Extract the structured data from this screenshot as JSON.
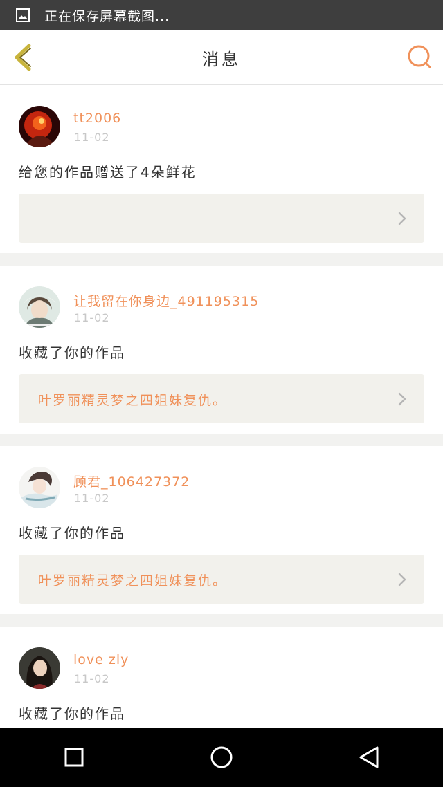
{
  "status_bar": {
    "text": "正在保存屏幕截图..."
  },
  "header": {
    "title": "消息"
  },
  "messages": [
    {
      "username": "tt2006",
      "date": "11-02",
      "action": "给您的作品赠送了4朵鲜花",
      "work_title": ""
    },
    {
      "username": "让我留在你身边_491195315",
      "date": "11-02",
      "action": "收藏了你的作品",
      "work_title": "叶罗丽精灵梦之四姐妹复仇。"
    },
    {
      "username": "顾君_106427372",
      "date": "11-02",
      "action": "收藏了你的作品",
      "work_title": "叶罗丽精灵梦之四姐妹复仇。"
    },
    {
      "username": "love zly",
      "date": "11-02",
      "action": "收藏了你的作品",
      "work_title": ""
    }
  ],
  "colors": {
    "accent": "#f0915a",
    "back_arrow": "#c8b43c"
  }
}
